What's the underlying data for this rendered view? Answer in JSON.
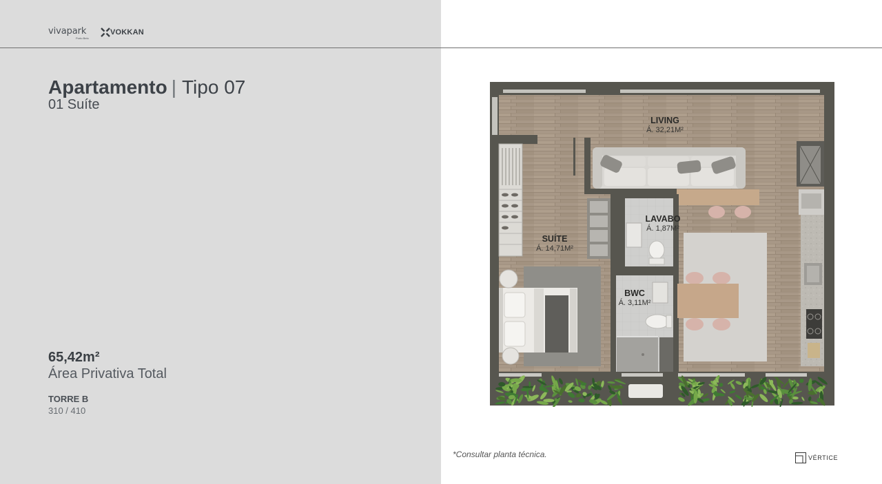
{
  "brands": {
    "vivapark": "vivapark",
    "vivapark_tagline": "Porto Belo",
    "vokkan": "VOKKAN",
    "vertice": "VÉRTICE"
  },
  "unit": {
    "title": "Apartamento",
    "separator": "|",
    "type": "Tipo 07",
    "subtitle": "01 Suíte"
  },
  "area": {
    "value": "65,42m²",
    "label": "Área Privativa Total"
  },
  "tower": {
    "name": "TORRE B",
    "units": "310 / 410"
  },
  "floor_plan": {
    "rooms": [
      {
        "name": "LIVING",
        "area": "Á. 32,21M²"
      },
      {
        "name": "LAVABO",
        "area": "Á. 1,87M²"
      },
      {
        "name": "SUÍTE",
        "area": "Á. 14,71M²"
      },
      {
        "name": "BWC",
        "area": "Á. 3,11M²"
      }
    ]
  },
  "footnote": "*Consultar planta técnica.",
  "colors": {
    "left_panel": "#dcdcdc",
    "text_dark": "#3d4248",
    "wall": "#57564f",
    "wood_floor": "#a89887",
    "accent_pink": "#d6b3aa"
  }
}
